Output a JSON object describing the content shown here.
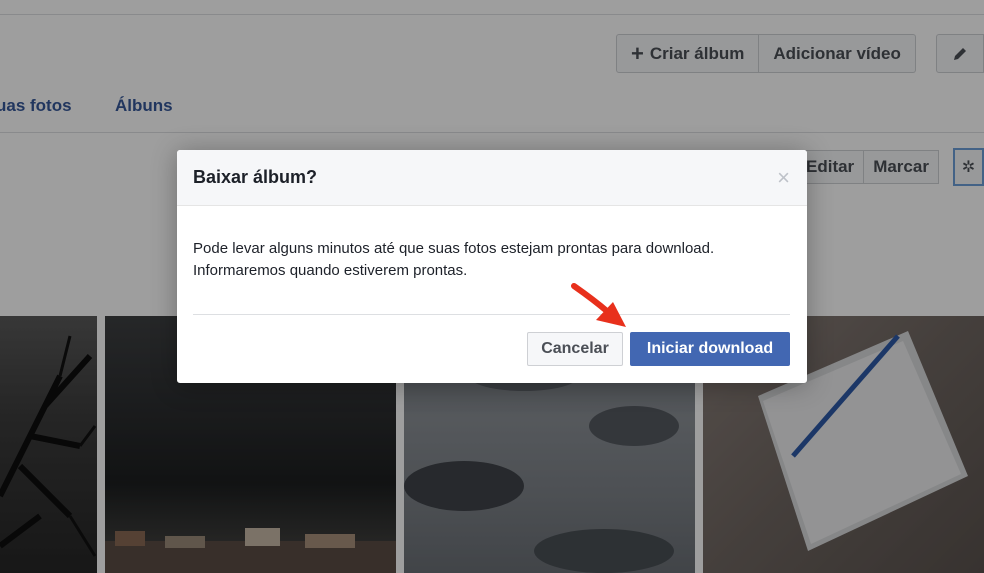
{
  "toolbar": {
    "create_album": "Criar álbum",
    "add_video": "Adicionar vídeo"
  },
  "tabs": {
    "photos": "uas fotos",
    "albums": "Álbuns"
  },
  "album_actions": {
    "edit": "Editar",
    "tag": "Marcar"
  },
  "dialog": {
    "title": "Baixar álbum?",
    "close": "×",
    "body_line1": "Pode levar alguns minutos até que suas fotos estejam prontas para download.",
    "body_line2": "Informaremos quando estiverem prontas.",
    "cancel": "Cancelar",
    "confirm": "Iniciar download"
  },
  "icons": {
    "plus": "plus-icon",
    "pencil": "pencil-icon",
    "gear": "gear-icon",
    "arrow": "red-arrow-annotation"
  },
  "colors": {
    "primary_button": "#4267b2",
    "link": "#365899",
    "arrow": "#e8301c"
  }
}
